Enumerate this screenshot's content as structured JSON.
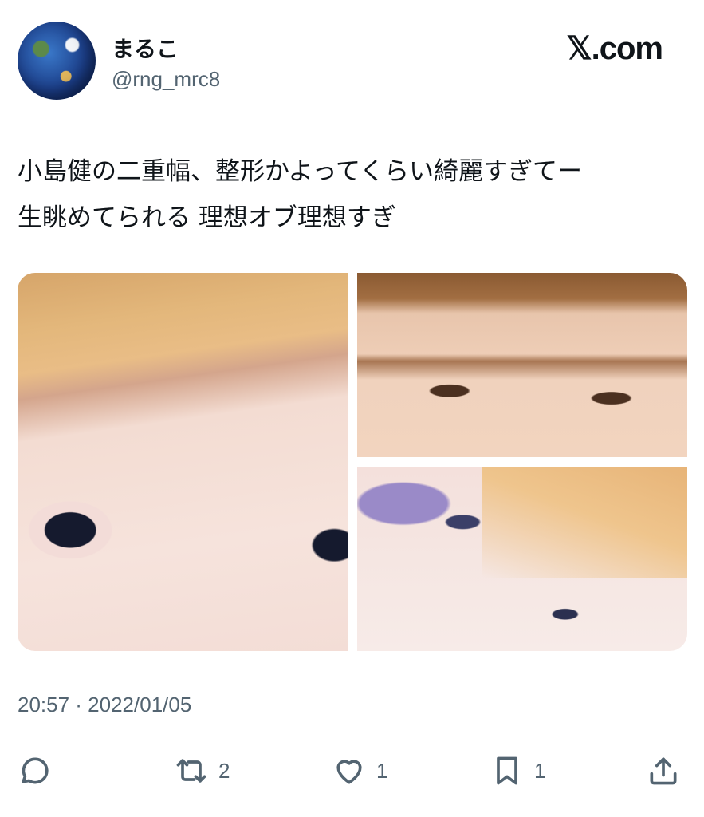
{
  "author": {
    "display_name": "まるこ",
    "handle": "@rng_mrc8"
  },
  "brand": {
    "label": "𝕏.com"
  },
  "tweet": {
    "text_line1": "小島健の二重幅、整形かよってくらい綺麗すぎてー",
    "text_line2": "生眺めてられる 理想オブ理想すぎ",
    "timestamp": "20:57 · 2022/01/05"
  },
  "media": {
    "count": 3
  },
  "actions": {
    "reply": {
      "icon": "reply-icon",
      "count": ""
    },
    "retweet": {
      "icon": "retweet-icon",
      "count": "2"
    },
    "like": {
      "icon": "heart-icon",
      "count": "1"
    },
    "bookmark": {
      "icon": "bookmark-icon",
      "count": "1"
    },
    "share": {
      "icon": "share-icon",
      "count": ""
    }
  },
  "colors": {
    "text": "#0f1419",
    "secondary": "#536471",
    "background": "#ffffff"
  }
}
